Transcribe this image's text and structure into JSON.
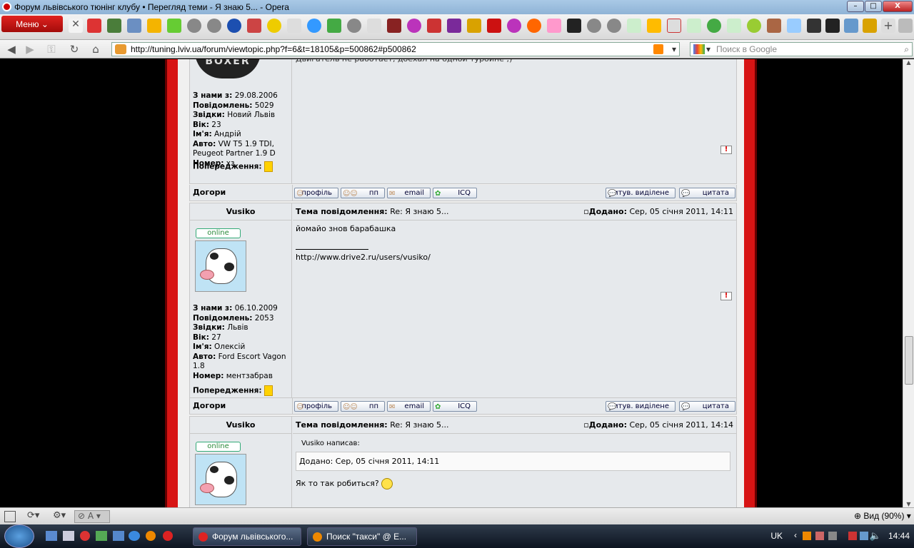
{
  "window": {
    "title": "Форум львівського тюнінг клубу • Перегляд теми - Я знаю 5... - Opera",
    "minimize": "–",
    "maximize": "□",
    "close": "X"
  },
  "toolbar": {
    "menu_label": "Меню"
  },
  "addressbar": {
    "url": "http://tuning.lviv.ua/forum/viewtopic.php?f=6&t=18105&p=500862#p500862",
    "search_placeholder": "Поиск в Google"
  },
  "post1": {
    "avatar_text": "BOXER",
    "message_fragment": "Двигатель не работает, доехал на одной турбине ;)",
    "info": [
      {
        "label": "З нами з:",
        "value": "29.08.2006"
      },
      {
        "label": "Повідомлень:",
        "value": "5029"
      },
      {
        "label": "Звідки:",
        "value": "Новий Львів"
      },
      {
        "label": "Вік:",
        "value": "23"
      },
      {
        "label": "Ім'я:",
        "value": "Андрій"
      },
      {
        "label": "Авто:",
        "value": "VW T5 1.9 TDI, Peugeot Partner 1.9 D"
      },
      {
        "label": "Номер:",
        "value": "хз"
      }
    ],
    "warnings_label": "Попередження:"
  },
  "buttons": {
    "top": "Догори",
    "profile": "профіль",
    "pm": "пп",
    "email": "email",
    "icq": "ICQ",
    "quote_selected": "цитув. виділене",
    "quote": "цитата",
    "report": "!"
  },
  "post2": {
    "author": "Vusiko",
    "subject_label": "Тема повідомлення:",
    "subject": "Re: Я знаю 5...",
    "added_label": "Додано:",
    "added": "Сер, 05 січня 2011, 14:11",
    "online": "online",
    "body": "йомайо знов барабашка",
    "signature_line": "__________________",
    "signature": "http://www.drive2.ru/users/vusiko/",
    "info": [
      {
        "label": "З нами з:",
        "value": "06.10.2009"
      },
      {
        "label": "Повідомлень:",
        "value": "2053"
      },
      {
        "label": "Звідки:",
        "value": "Львів"
      },
      {
        "label": "Вік:",
        "value": "27"
      },
      {
        "label": "Ім'я:",
        "value": "Олексій"
      },
      {
        "label": "Авто:",
        "value": "Ford Escort Vagon 1.8"
      },
      {
        "label": "Номер:",
        "value": "ментзабрав"
      }
    ],
    "warnings_label": "Попередження:"
  },
  "post3": {
    "author": "Vusiko",
    "subject_label": "Тема повідомлення:",
    "subject": "Re: Я знаю 5...",
    "added_label": "Додано:",
    "added": "Сер, 05 січня 2011, 14:14",
    "online": "online",
    "quote_author": "Vusiko написав:",
    "quote_text": "Додано: Сер, 05 січня 2011, 14:11",
    "body": "Як то так робиться?"
  },
  "statusbar": {
    "zoom": "Вид (90%)"
  },
  "taskbar": {
    "task1": "Форум львівського...",
    "task2": "Поиск \"такси\" @ Е...",
    "lang": "UK",
    "clock": "14:44"
  }
}
